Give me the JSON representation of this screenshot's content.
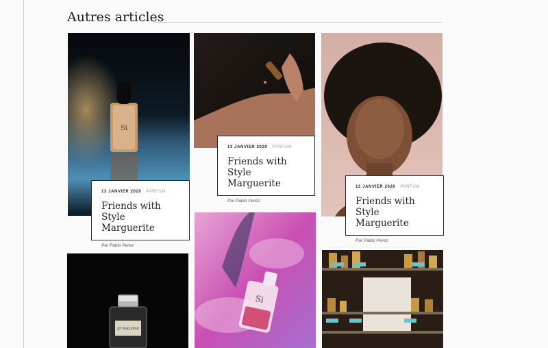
{
  "section": {
    "title": "Autres articles"
  },
  "articles": [
    {
      "date": "13 JANVIER 2020",
      "category": "PARFUM",
      "title": "Friends with Style Marguerite",
      "author": "Par Pablo Perez",
      "image": "perfume-bottle-on-reflection"
    },
    {
      "date": "13 JANVIER 2020",
      "category": "PARFUM",
      "title": "Friends with Style Marguerite",
      "author": "Par Pablo Perez",
      "image": "hands-holding-perfume-dropper"
    },
    {
      "date": "13 JANVIER 2020",
      "category": "PARFUM",
      "title": "Friends with Style Marguerite",
      "author": "Par Pablo Perez",
      "image": "woman-portrait"
    },
    {
      "image": "jo-malone-bottle",
      "bottle_label": "JO MALONE"
    },
    {
      "image": "perfume-in-pink-water",
      "bottle_label": "Si"
    },
    {
      "image": "perfume-shop-shelves"
    }
  ]
}
